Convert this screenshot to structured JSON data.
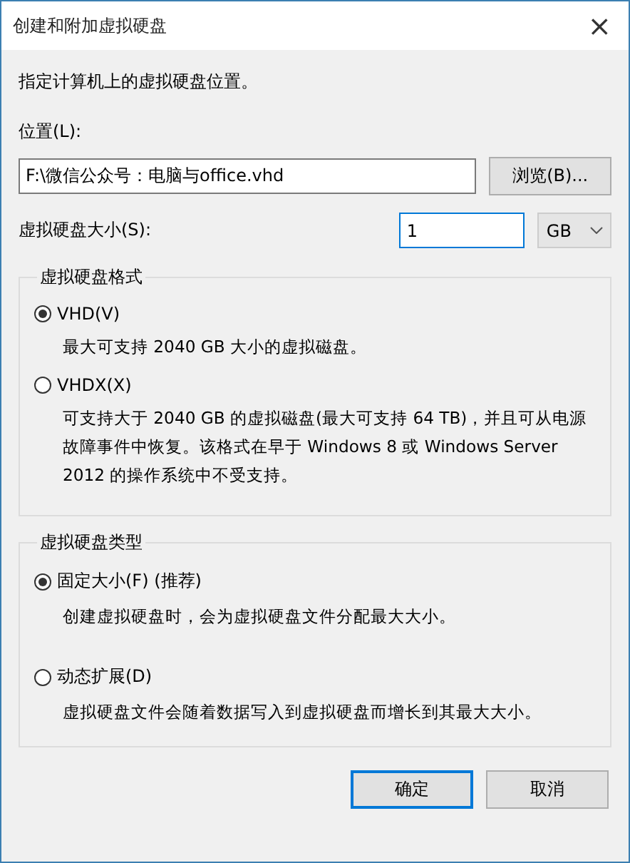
{
  "window": {
    "title": "创建和附加虚拟硬盘",
    "close": "×"
  },
  "intro": "指定计算机上的虚拟硬盘位置。",
  "location": {
    "label": "位置(L):",
    "value": "F:\\微信公众号：电脑与office.vhd",
    "browse": "浏览(B)..."
  },
  "size": {
    "label": "虚拟硬盘大小(S):",
    "value": "1",
    "unit": "GB"
  },
  "groups": [
    {
      "title": "虚拟硬盘格式",
      "options": [
        {
          "label": "VHD(V)",
          "selected": true,
          "description": "最大可支持 2040 GB 大小的虚拟磁盘。"
        },
        {
          "label": "VHDX(X)",
          "selected": false,
          "description": "可支持大于 2040 GB 的虚拟磁盘(最大可支持 64 TB)，并且可从电源故障事件中恢复。该格式在早于 Windows 8 或 Windows Server 2012 的操作系统中不受支持。"
        }
      ]
    },
    {
      "title": "虚拟硬盘类型",
      "options": [
        {
          "label": "固定大小(F) (推荐)",
          "selected": true,
          "description": "创建虚拟硬盘时，会为虚拟硬盘文件分配最大大小。"
        },
        {
          "label": "动态扩展(D)",
          "selected": false,
          "description": "虚拟硬盘文件会随着数据写入到虚拟硬盘而增长到其最大大小。"
        }
      ]
    }
  ],
  "buttons": [
    {
      "label": "确定",
      "default": true
    },
    {
      "label": "取消",
      "default": false
    }
  ]
}
